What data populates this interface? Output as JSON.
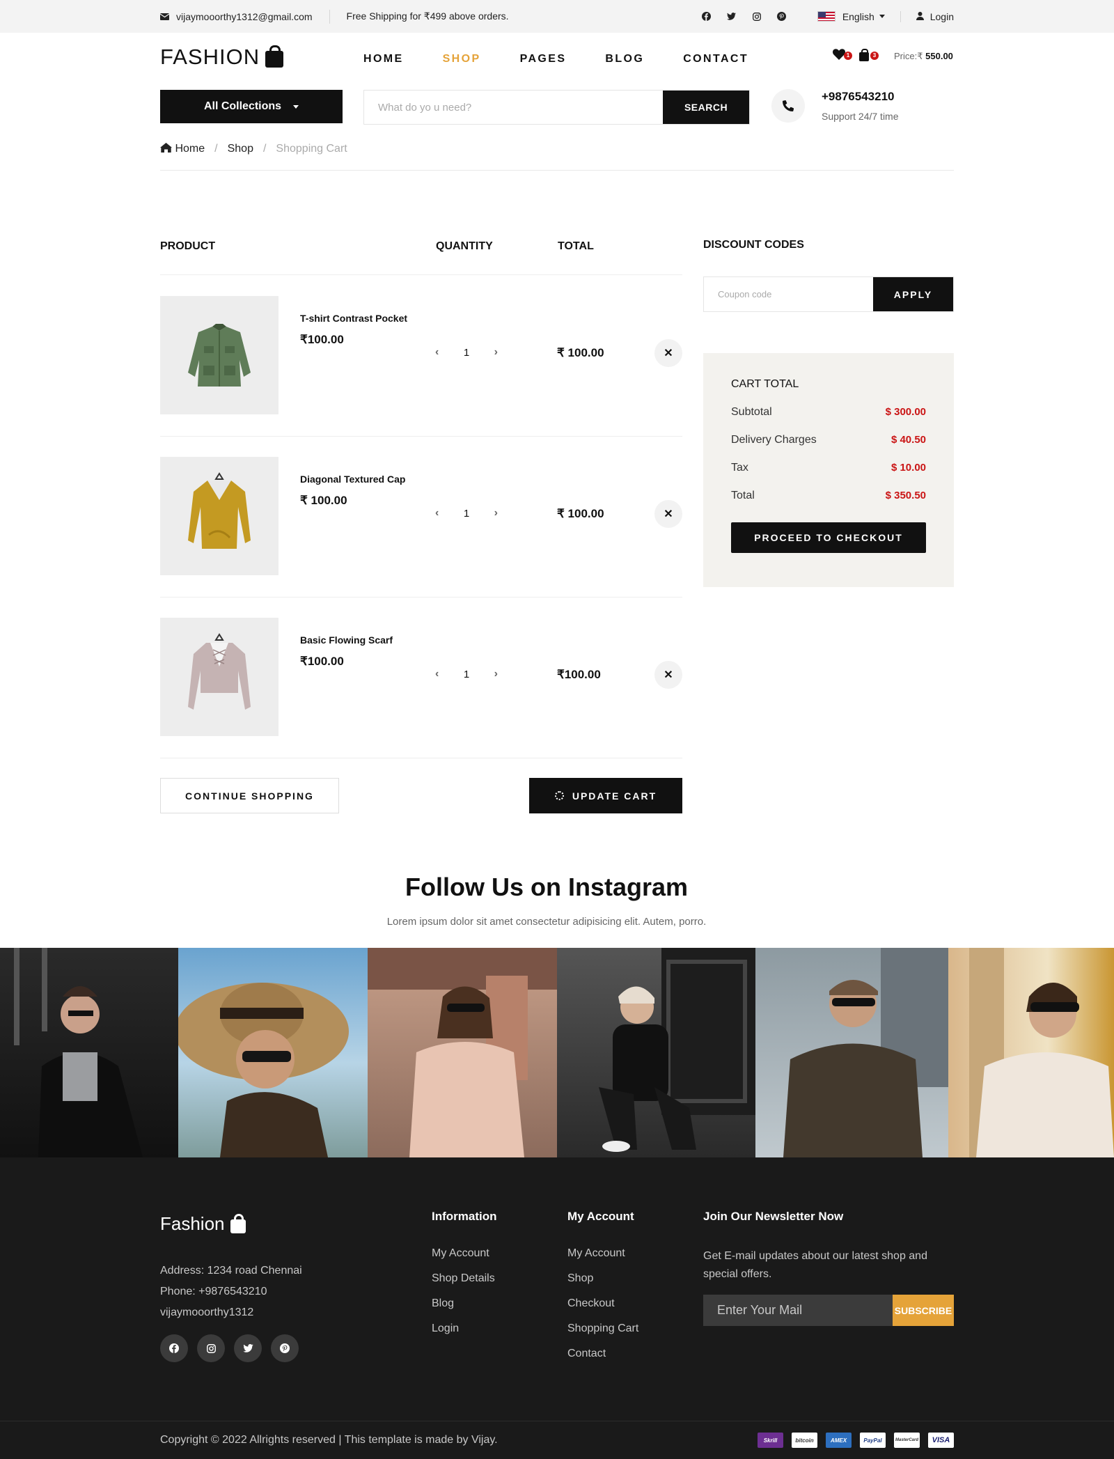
{
  "topbar": {
    "email": "vijaymooorthy1312@gmail.com",
    "shipping": "Free Shipping for ₹499 above orders.",
    "social_icons": [
      "facebook-icon",
      "twitter-icon",
      "instagram-icon",
      "pinterest-icon"
    ],
    "language": "English",
    "login": "Login"
  },
  "header": {
    "logo": "FASHION",
    "nav": [
      "HOME",
      "SHOP",
      "PAGES",
      "BLOG",
      "CONTACT"
    ],
    "active_nav": "SHOP",
    "wishlist_count": "1",
    "cart_count": "3",
    "price_label": "Price:₹",
    "price_value": "550.00",
    "collections": "All Collections",
    "search_placeholder": "What do yo u need?",
    "search_button": "SEARCH",
    "phone": "+9876543210",
    "support": "Support 24/7 time"
  },
  "breadcrumb": [
    "Home",
    "Shop",
    "Shopping Cart"
  ],
  "cart": {
    "headers": {
      "product": "PRODUCT",
      "quantity": "QUANTITY",
      "total": "TOTAL"
    },
    "items": [
      {
        "name": "T-shirt Contrast Pocket",
        "price": "₹100.00",
        "quantity": "1",
        "total": "₹ 100.00"
      },
      {
        "name": "Diagonal Textured Cap",
        "price": "₹ 100.00",
        "quantity": "1",
        "total": "₹ 100.00"
      },
      {
        "name": "Basic Flowing Scarf",
        "price": "₹100.00",
        "quantity": "1",
        "total": "₹100.00"
      }
    ],
    "continue": "CONTINUE SHOPPING",
    "update": "UPDATE CART"
  },
  "discount": {
    "title": "DISCOUNT CODES",
    "placeholder": "Coupon code",
    "apply": "APPLY"
  },
  "cart_total": {
    "title": "CART TOTAL",
    "rows": [
      {
        "label": "Subtotal",
        "value": "$ 300.00"
      },
      {
        "label": "Delivery Charges",
        "value": "$ 40.50"
      },
      {
        "label": "Tax",
        "value": "$ 10.00"
      },
      {
        "label": "Total",
        "value": "$ 350.50"
      }
    ],
    "checkout": "PROCEED TO CHECKOUT"
  },
  "instagram": {
    "title": "Follow Us on Instagram",
    "subtitle": "Lorem ipsum dolor sit amet consectetur adipisicing elit. Autem, porro."
  },
  "footer": {
    "logo": "Fashion",
    "address": "Address: 1234 road Chennai",
    "phone": "Phone: +9876543210",
    "email": "vijaymooorthy1312",
    "info_title": "Information",
    "info_links": [
      "My Account",
      "Shop Details",
      "Blog",
      "Login"
    ],
    "account_title": "My Account",
    "account_links": [
      "My Account",
      "Shop",
      "Checkout",
      "Shopping Cart",
      "Contact"
    ],
    "newsletter_title": "Join Our Newsletter Now",
    "newsletter_text": "Get E-mail updates about our latest shop and special offers.",
    "newsletter_placeholder": "Enter Your Mail",
    "subscribe": "SUBSCRIBE",
    "copyright": "Copyright © 2022 Allrights reserved | This template is made by Vijay.",
    "payments": [
      "Skrill",
      "bitcoin",
      "AMEX",
      "PayPal",
      "MasterCard",
      "VISA"
    ]
  },
  "colors": {
    "accent": "#e5a339",
    "price_red": "#ca1515",
    "dark": "#111111",
    "footer_bg": "#1a1a1a"
  }
}
